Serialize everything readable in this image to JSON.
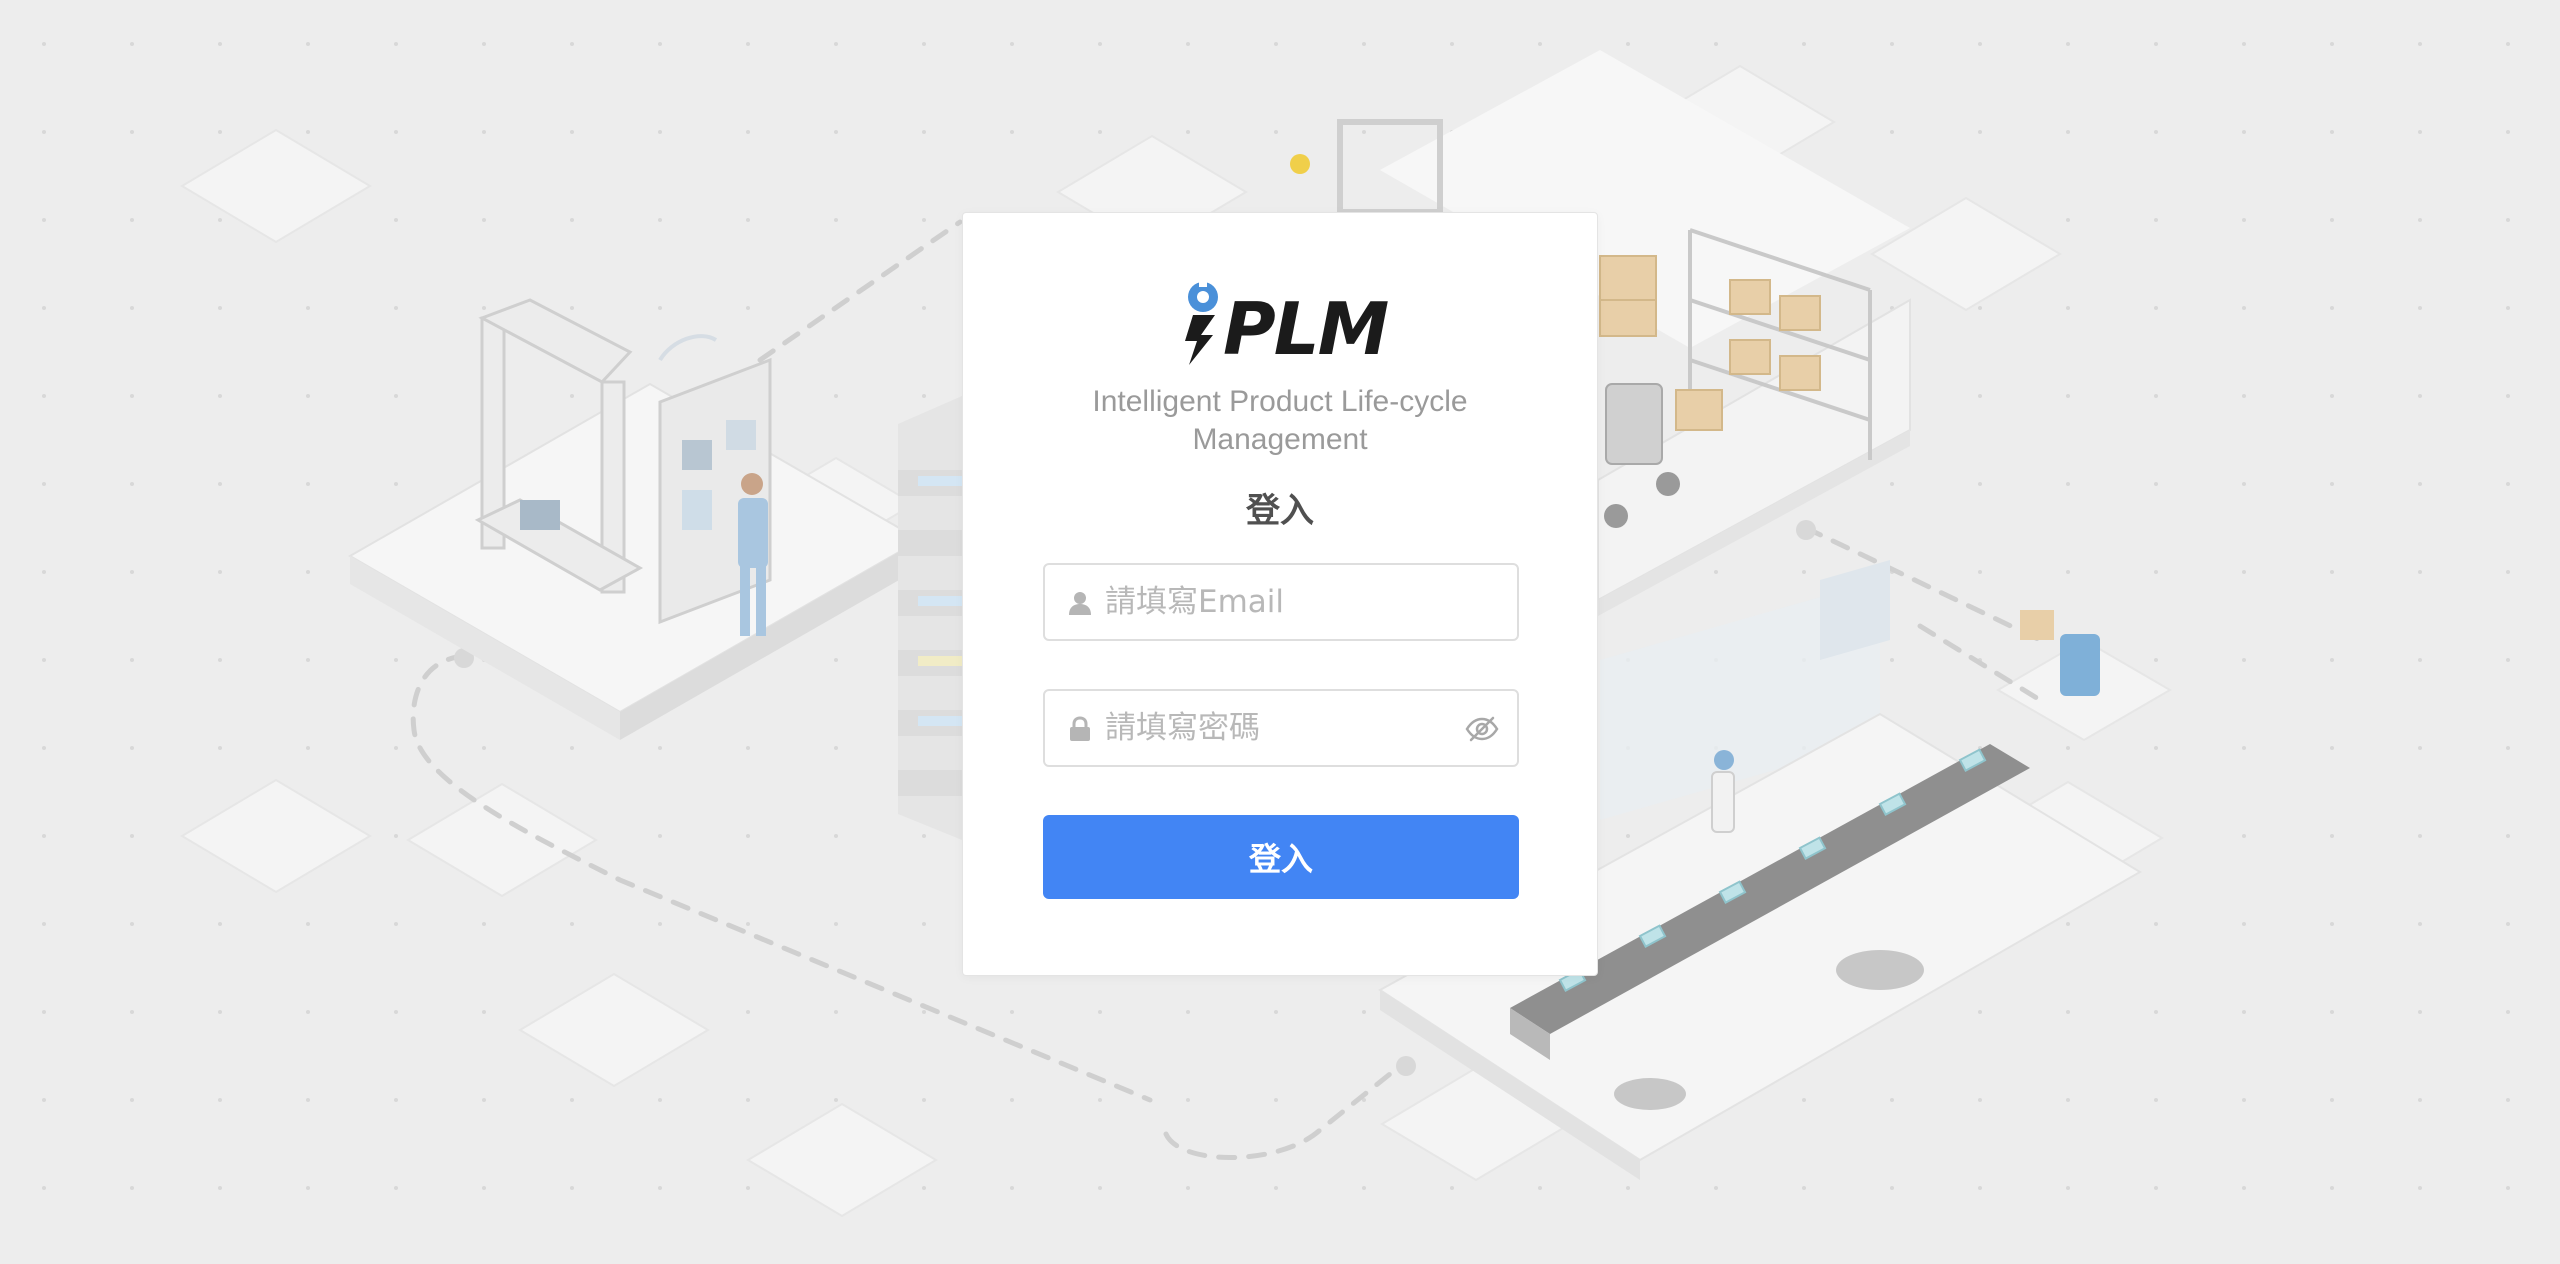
{
  "brand": {
    "logo_text": "PLM",
    "subtitle": "Intelligent Product Life-cycle Management",
    "colors": {
      "logo_accent": "#4a90d9",
      "logo_dark": "#1b1b1b"
    }
  },
  "login": {
    "title": "登入",
    "email": {
      "placeholder": "請填寫Email",
      "value": "",
      "icon": "user-icon"
    },
    "password": {
      "placeholder": "請填寫密碼",
      "value": "",
      "icon": "lock-icon",
      "toggle_icon": "eye-slash-icon"
    },
    "submit_label": "登入"
  },
  "theme": {
    "background": "#ededed",
    "card": "#ffffff",
    "primary": "#4285f4",
    "placeholder": "#b8b8b8"
  }
}
